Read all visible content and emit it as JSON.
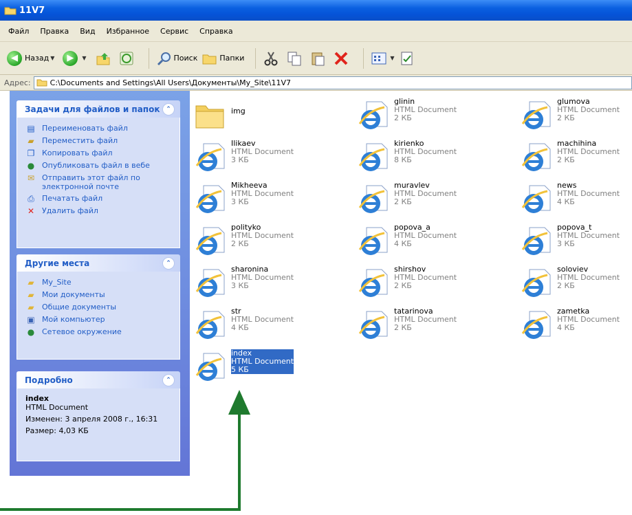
{
  "window": {
    "title": "11V7"
  },
  "menu": [
    "Файл",
    "Правка",
    "Вид",
    "Избранное",
    "Сервис",
    "Справка"
  ],
  "toolbar": {
    "back": "Назад",
    "search": "Поиск",
    "folders": "Папки"
  },
  "address": {
    "label": "Адрес:",
    "path": "C:\\Documents and Settings\\All Users\\Документы\\My_Site\\11V7"
  },
  "tasks_panel": {
    "title": "Задачи для файлов и папок",
    "items": [
      "Переименовать файл",
      "Переместить файл",
      "Копировать файл",
      "Опубликовать файл в вебе",
      "Отправить этот файл по электронной почте",
      "Печатать файл",
      "Удалить файл"
    ]
  },
  "places_panel": {
    "title": "Другие места",
    "items": [
      "My_Site",
      "Мои документы",
      "Общие документы",
      "Мой компьютер",
      "Сетевое окружение"
    ]
  },
  "details_panel": {
    "title": "Подробно",
    "name": "index",
    "type": "HTML Document",
    "modified": "Изменен: 3 апреля 2008 г., 16:31",
    "size": "Размер: 4,03 КБ"
  },
  "files": [
    {
      "name": "img",
      "type": "",
      "size": "",
      "kind": "folder"
    },
    {
      "name": "glinin",
      "type": "HTML Document",
      "size": "2 КБ",
      "kind": "html"
    },
    {
      "name": "glumova",
      "type": "HTML Document",
      "size": "2 КБ",
      "kind": "html"
    },
    {
      "name": "Ilikaev",
      "type": "HTML Document",
      "size": "3 КБ",
      "kind": "html"
    },
    {
      "name": "kirienko",
      "type": "HTML Document",
      "size": "8 КБ",
      "kind": "html"
    },
    {
      "name": "machihina",
      "type": "HTML Document",
      "size": "2 КБ",
      "kind": "html"
    },
    {
      "name": "Mikheeva",
      "type": "HTML Document",
      "size": "3 КБ",
      "kind": "html"
    },
    {
      "name": "muravlev",
      "type": "HTML Document",
      "size": "2 КБ",
      "kind": "html"
    },
    {
      "name": "news",
      "type": "HTML Document",
      "size": "4 КБ",
      "kind": "html"
    },
    {
      "name": "polityko",
      "type": "HTML Document",
      "size": "2 КБ",
      "kind": "html"
    },
    {
      "name": "popova_a",
      "type": "HTML Document",
      "size": "4 КБ",
      "kind": "html"
    },
    {
      "name": "popova_t",
      "type": "HTML Document",
      "size": "3 КБ",
      "kind": "html"
    },
    {
      "name": "sharonina",
      "type": "HTML Document",
      "size": "3 КБ",
      "kind": "html"
    },
    {
      "name": "shirshov",
      "type": "HTML Document",
      "size": "2 КБ",
      "kind": "html"
    },
    {
      "name": "soloviev",
      "type": "HTML Document",
      "size": "2 КБ",
      "kind": "html"
    },
    {
      "name": "str",
      "type": "HTML Document",
      "size": "4 КБ",
      "kind": "html"
    },
    {
      "name": "tatarinova",
      "type": "HTML Document",
      "size": "2 КБ",
      "kind": "html"
    },
    {
      "name": "zametka",
      "type": "HTML Document",
      "size": "4 КБ",
      "kind": "html"
    },
    {
      "name": "index",
      "type": "HTML Document",
      "size": "5 КБ",
      "kind": "html",
      "selected": true
    }
  ],
  "colors": {
    "arrow": "#1f7a2e",
    "selection": "#316ac5",
    "task_link": "#215dc6"
  }
}
